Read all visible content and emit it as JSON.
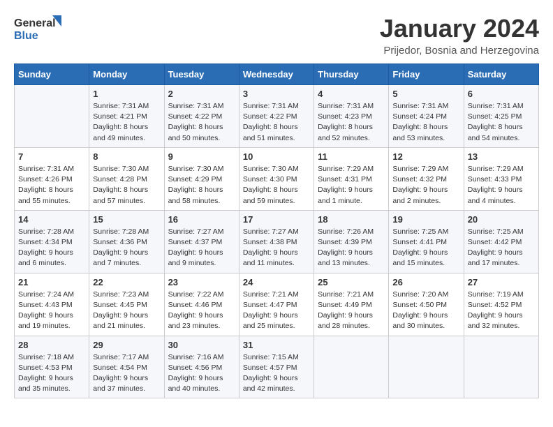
{
  "header": {
    "logo_line1": "General",
    "logo_line2": "Blue",
    "month_title": "January 2024",
    "location": "Prijedor, Bosnia and Herzegovina"
  },
  "weekdays": [
    "Sunday",
    "Monday",
    "Tuesday",
    "Wednesday",
    "Thursday",
    "Friday",
    "Saturday"
  ],
  "weeks": [
    [
      {
        "day": "",
        "sunrise": "",
        "sunset": "",
        "daylight": ""
      },
      {
        "day": "1",
        "sunrise": "Sunrise: 7:31 AM",
        "sunset": "Sunset: 4:21 PM",
        "daylight": "Daylight: 8 hours and 49 minutes."
      },
      {
        "day": "2",
        "sunrise": "Sunrise: 7:31 AM",
        "sunset": "Sunset: 4:22 PM",
        "daylight": "Daylight: 8 hours and 50 minutes."
      },
      {
        "day": "3",
        "sunrise": "Sunrise: 7:31 AM",
        "sunset": "Sunset: 4:22 PM",
        "daylight": "Daylight: 8 hours and 51 minutes."
      },
      {
        "day": "4",
        "sunrise": "Sunrise: 7:31 AM",
        "sunset": "Sunset: 4:23 PM",
        "daylight": "Daylight: 8 hours and 52 minutes."
      },
      {
        "day": "5",
        "sunrise": "Sunrise: 7:31 AM",
        "sunset": "Sunset: 4:24 PM",
        "daylight": "Daylight: 8 hours and 53 minutes."
      },
      {
        "day": "6",
        "sunrise": "Sunrise: 7:31 AM",
        "sunset": "Sunset: 4:25 PM",
        "daylight": "Daylight: 8 hours and 54 minutes."
      }
    ],
    [
      {
        "day": "7",
        "sunrise": "Sunrise: 7:31 AM",
        "sunset": "Sunset: 4:26 PM",
        "daylight": "Daylight: 8 hours and 55 minutes."
      },
      {
        "day": "8",
        "sunrise": "Sunrise: 7:30 AM",
        "sunset": "Sunset: 4:28 PM",
        "daylight": "Daylight: 8 hours and 57 minutes."
      },
      {
        "day": "9",
        "sunrise": "Sunrise: 7:30 AM",
        "sunset": "Sunset: 4:29 PM",
        "daylight": "Daylight: 8 hours and 58 minutes."
      },
      {
        "day": "10",
        "sunrise": "Sunrise: 7:30 AM",
        "sunset": "Sunset: 4:30 PM",
        "daylight": "Daylight: 8 hours and 59 minutes."
      },
      {
        "day": "11",
        "sunrise": "Sunrise: 7:29 AM",
        "sunset": "Sunset: 4:31 PM",
        "daylight": "Daylight: 9 hours and 1 minute."
      },
      {
        "day": "12",
        "sunrise": "Sunrise: 7:29 AM",
        "sunset": "Sunset: 4:32 PM",
        "daylight": "Daylight: 9 hours and 2 minutes."
      },
      {
        "day": "13",
        "sunrise": "Sunrise: 7:29 AM",
        "sunset": "Sunset: 4:33 PM",
        "daylight": "Daylight: 9 hours and 4 minutes."
      }
    ],
    [
      {
        "day": "14",
        "sunrise": "Sunrise: 7:28 AM",
        "sunset": "Sunset: 4:34 PM",
        "daylight": "Daylight: 9 hours and 6 minutes."
      },
      {
        "day": "15",
        "sunrise": "Sunrise: 7:28 AM",
        "sunset": "Sunset: 4:36 PM",
        "daylight": "Daylight: 9 hours and 7 minutes."
      },
      {
        "day": "16",
        "sunrise": "Sunrise: 7:27 AM",
        "sunset": "Sunset: 4:37 PM",
        "daylight": "Daylight: 9 hours and 9 minutes."
      },
      {
        "day": "17",
        "sunrise": "Sunrise: 7:27 AM",
        "sunset": "Sunset: 4:38 PM",
        "daylight": "Daylight: 9 hours and 11 minutes."
      },
      {
        "day": "18",
        "sunrise": "Sunrise: 7:26 AM",
        "sunset": "Sunset: 4:39 PM",
        "daylight": "Daylight: 9 hours and 13 minutes."
      },
      {
        "day": "19",
        "sunrise": "Sunrise: 7:25 AM",
        "sunset": "Sunset: 4:41 PM",
        "daylight": "Daylight: 9 hours and 15 minutes."
      },
      {
        "day": "20",
        "sunrise": "Sunrise: 7:25 AM",
        "sunset": "Sunset: 4:42 PM",
        "daylight": "Daylight: 9 hours and 17 minutes."
      }
    ],
    [
      {
        "day": "21",
        "sunrise": "Sunrise: 7:24 AM",
        "sunset": "Sunset: 4:43 PM",
        "daylight": "Daylight: 9 hours and 19 minutes."
      },
      {
        "day": "22",
        "sunrise": "Sunrise: 7:23 AM",
        "sunset": "Sunset: 4:45 PM",
        "daylight": "Daylight: 9 hours and 21 minutes."
      },
      {
        "day": "23",
        "sunrise": "Sunrise: 7:22 AM",
        "sunset": "Sunset: 4:46 PM",
        "daylight": "Daylight: 9 hours and 23 minutes."
      },
      {
        "day": "24",
        "sunrise": "Sunrise: 7:21 AM",
        "sunset": "Sunset: 4:47 PM",
        "daylight": "Daylight: 9 hours and 25 minutes."
      },
      {
        "day": "25",
        "sunrise": "Sunrise: 7:21 AM",
        "sunset": "Sunset: 4:49 PM",
        "daylight": "Daylight: 9 hours and 28 minutes."
      },
      {
        "day": "26",
        "sunrise": "Sunrise: 7:20 AM",
        "sunset": "Sunset: 4:50 PM",
        "daylight": "Daylight: 9 hours and 30 minutes."
      },
      {
        "day": "27",
        "sunrise": "Sunrise: 7:19 AM",
        "sunset": "Sunset: 4:52 PM",
        "daylight": "Daylight: 9 hours and 32 minutes."
      }
    ],
    [
      {
        "day": "28",
        "sunrise": "Sunrise: 7:18 AM",
        "sunset": "Sunset: 4:53 PM",
        "daylight": "Daylight: 9 hours and 35 minutes."
      },
      {
        "day": "29",
        "sunrise": "Sunrise: 7:17 AM",
        "sunset": "Sunset: 4:54 PM",
        "daylight": "Daylight: 9 hours and 37 minutes."
      },
      {
        "day": "30",
        "sunrise": "Sunrise: 7:16 AM",
        "sunset": "Sunset: 4:56 PM",
        "daylight": "Daylight: 9 hours and 40 minutes."
      },
      {
        "day": "31",
        "sunrise": "Sunrise: 7:15 AM",
        "sunset": "Sunset: 4:57 PM",
        "daylight": "Daylight: 9 hours and 42 minutes."
      },
      {
        "day": "",
        "sunrise": "",
        "sunset": "",
        "daylight": ""
      },
      {
        "day": "",
        "sunrise": "",
        "sunset": "",
        "daylight": ""
      },
      {
        "day": "",
        "sunrise": "",
        "sunset": "",
        "daylight": ""
      }
    ]
  ]
}
